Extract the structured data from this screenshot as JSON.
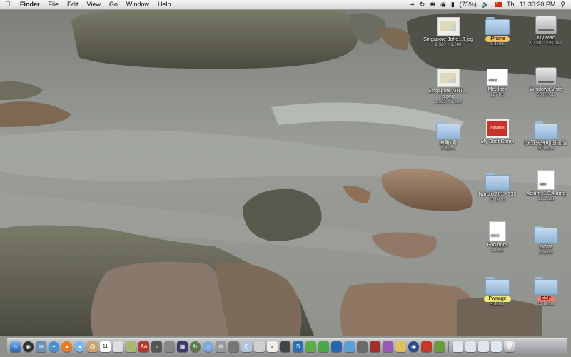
{
  "menubar": {
    "apple_icon": "apple-icon",
    "app_name": "Finder",
    "menus": [
      "File",
      "Edit",
      "View",
      "Go",
      "Window",
      "Help"
    ],
    "battery": "(73%)",
    "clock": "Thu 11:30:20 PM"
  },
  "desktop_icons": [
    {
      "name": "Singapore Joho...T.jpg",
      "sub": "2,320 × 1,600",
      "kind": "image"
    },
    {
      "name": "iPhone",
      "sub": "5 items",
      "kind": "folder",
      "label_color": "#f4c06a"
    },
    {
      "name": "My Mac",
      "sub": "97.88 ... GB free",
      "kind": "disk"
    },
    {
      "name": "Singapore MRT ... p.png",
      "sub": "1,925 × 1,339",
      "kind": "image"
    },
    {
      "name": "Me.docx",
      "sub": "127 KB",
      "kind": "docx"
    },
    {
      "name": "Windows Vista",
      "sub": "50.86 GB",
      "kind": "disk"
    },
    {
      "name": "海角7号",
      "sub": "2 items",
      "kind": "folder"
    },
    {
      "name": "My Boot Camp",
      "sub": "",
      "kind": "bootcamp"
    },
    {
      "name": "[法证先锋II][国语]全",
      "sub": "30 items",
      "kind": "folder"
    },
    {
      "name": "Naruto 301 - 333",
      "sub": "20 items",
      "kind": "folder"
    },
    {
      "name": "Adium_1.3.4.dmg",
      "sub": "21.2 MB",
      "kind": "dmg"
    },
    {
      "name": "Pod.docx",
      "sub": "40 KB",
      "kind": "docx"
    },
    {
      "name": "DCIM",
      "sub": "2 items",
      "kind": "folder"
    },
    {
      "name": "Pwnage",
      "sub": "4 items",
      "kind": "folder",
      "label_color": "#f1ea7b"
    },
    {
      "name": "ECP",
      "sub": "62 items",
      "kind": "folder",
      "label_color": "#ee7a6c"
    }
  ],
  "dock": {
    "calendar_day": "11",
    "items": [
      "finder",
      "dashboard",
      "mail",
      "safari",
      "firefox",
      "ichat",
      "address-book",
      "ical",
      "preview",
      "iphoto",
      "dictionary",
      "itunes",
      "photo-booth",
      "spaces",
      "time-machine",
      "system-preferences",
      "network",
      "utilities",
      "textedit",
      "vlc",
      "activity",
      "transmission",
      "skype",
      "quicktime",
      "app",
      "app",
      "app",
      "app",
      "app",
      "app",
      "app",
      "app",
      "app",
      "app",
      "documents",
      "downloads",
      "stack",
      "stack",
      "trash"
    ]
  }
}
